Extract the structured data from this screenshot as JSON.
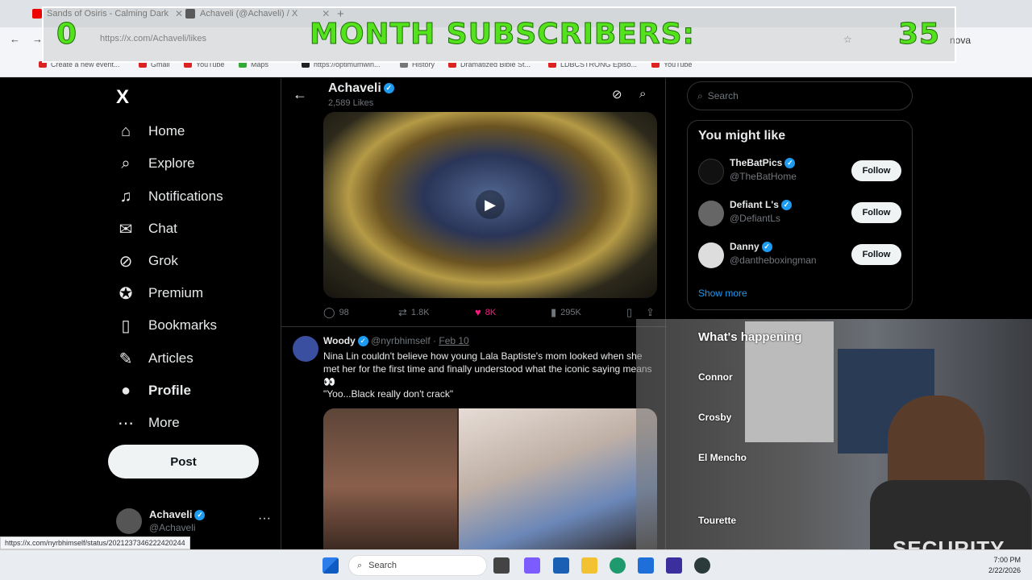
{
  "browser": {
    "tabs": [
      {
        "title": "Sands of Osiris - Calming Dark",
        "icon": "youtube-icon"
      },
      {
        "title": "Achaveli (@Achaveli) / X",
        "icon": "x-icon"
      }
    ],
    "url": "https://x.com/Achaveli/likes",
    "profile_label": "nova",
    "bookmarks": [
      "Create a new event...",
      "Gmail",
      "YouTube",
      "Maps",
      "https://optimumwin...",
      "History",
      "Dramatized Bible St...",
      "LDBCSTRONG Episo...",
      "YouTube"
    ],
    "status_url": "https://x.com/nyrbhimself/status/2021237346222420244"
  },
  "overlay": {
    "left_count": "0",
    "label": "MONTH SUBSCRIBERS:",
    "right_count": "35"
  },
  "nav": {
    "logo": "X",
    "items": [
      {
        "label": "Home",
        "icon": "home-icon"
      },
      {
        "label": "Explore",
        "icon": "search-icon"
      },
      {
        "label": "Notifications",
        "icon": "bell-icon"
      },
      {
        "label": "Chat",
        "icon": "mail-icon"
      },
      {
        "label": "Grok",
        "icon": "grok-icon"
      },
      {
        "label": "Premium",
        "icon": "premium-icon"
      },
      {
        "label": "Bookmarks",
        "icon": "bookmark-icon"
      },
      {
        "label": "Articles",
        "icon": "articles-icon"
      },
      {
        "label": "Profile",
        "icon": "person-icon"
      },
      {
        "label": "More",
        "icon": "more-icon"
      }
    ],
    "post_label": "Post",
    "account_name": "Achaveli",
    "account_handle": "@Achaveli",
    "account_more": "···"
  },
  "header": {
    "name": "Achaveli",
    "subtitle": "2,589 Likes",
    "back": "←"
  },
  "tweet1": {
    "replies": "98",
    "reposts": "1.8K",
    "likes": "8K",
    "views": "295K"
  },
  "tweet2": {
    "name": "Woody",
    "handle": "@nyrbhimself",
    "separator": "·",
    "date": "Feb 10",
    "text": "Nina Lin couldn't believe how young Lala Baptiste's mom looked when she met her for the first time and finally understood what the iconic saying means 👀",
    "quote": "\"Yoo...Black really don't crack\""
  },
  "sidebar": {
    "search_placeholder": "Search",
    "you_might_like": "You might like",
    "suggestions": [
      {
        "name": "TheBatPics",
        "handle": "@TheBatHome",
        "follow": "Follow"
      },
      {
        "name": "Defiant L's",
        "handle": "@DefiantLs",
        "follow": "Follow"
      },
      {
        "name": "Danny",
        "handle": "@dantheboxingman",
        "follow": "Follow"
      }
    ],
    "show_more": "Show more",
    "whats_happening": "What's happening",
    "trends": [
      "Connor",
      "Crosby",
      "El Mencho",
      "Tourette"
    ]
  },
  "webcam": {
    "shirt_text": "SECURITY"
  },
  "taskbar": {
    "search": "Search",
    "time": "7:00 PM",
    "date": "2/22/2026"
  },
  "colors": {
    "accent": "#1d9bf0",
    "like": "#f91880",
    "overlay_green": "#54e21d"
  }
}
